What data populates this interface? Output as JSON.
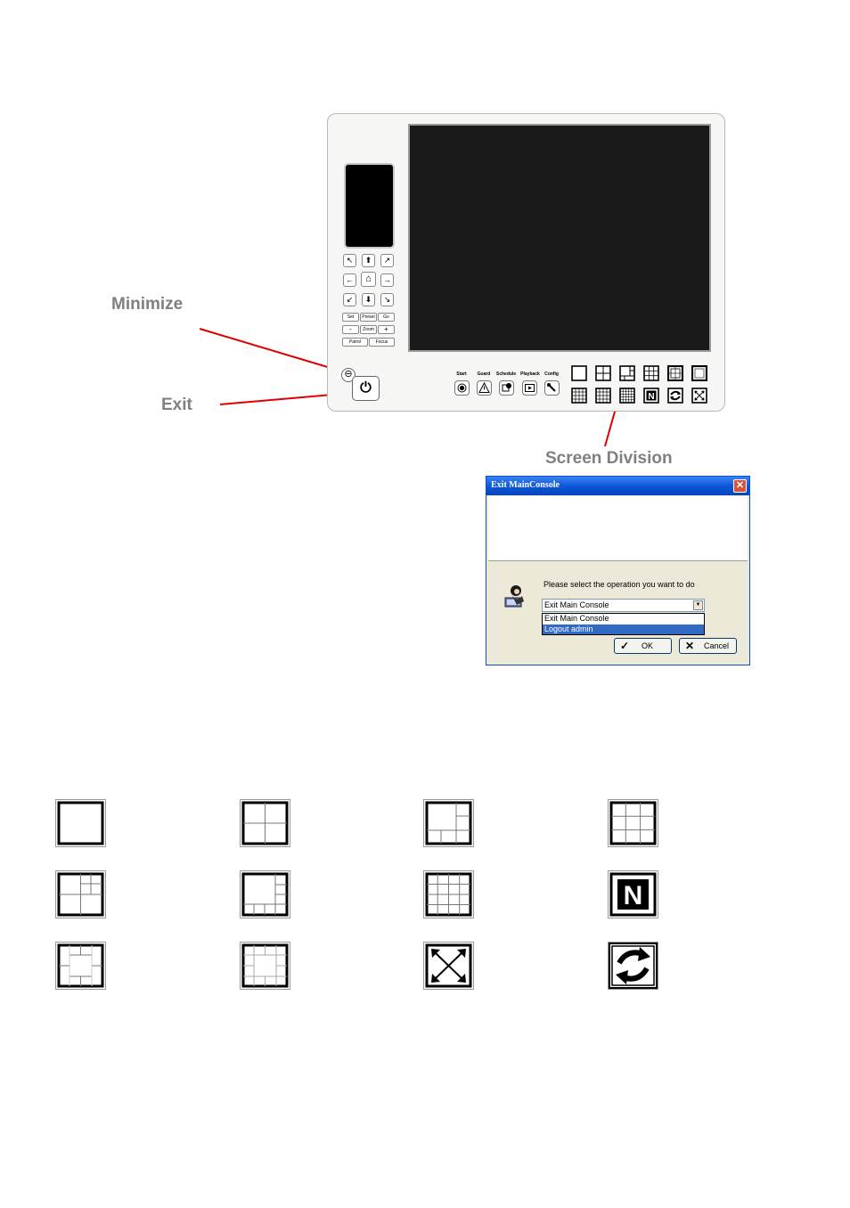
{
  "annotations": {
    "minimize": "Minimize",
    "exit": "Exit",
    "screen_division": "Screen Division"
  },
  "console": {
    "ptz_buttons": {
      "up_left": "↖",
      "up": "⬆",
      "up_right": "↗",
      "left": "←",
      "home": "⌂",
      "right": "→",
      "down_left": "↙",
      "down": "⬇",
      "down_right": "↘"
    },
    "preset_row": [
      "Set",
      "Preset",
      "Go"
    ],
    "zoom_row": [
      "-",
      "Zoom",
      "+"
    ],
    "focus_row": [
      "Patrol",
      "Focus"
    ],
    "controls": [
      {
        "label": "Start",
        "icon": "record-icon"
      },
      {
        "label": "Guard",
        "icon": "warning-icon"
      },
      {
        "label": "Schedule",
        "icon": "schedule-icon"
      },
      {
        "label": "Playback",
        "icon": "playback-icon"
      },
      {
        "label": "Config",
        "icon": "wrench-icon"
      }
    ],
    "minimize_glyph": "⊖",
    "exit_glyph": "⏻"
  },
  "dialog": {
    "title": "Exit MainConsole",
    "close_glyph": "✕",
    "prompt": "Please select the operation you want to do",
    "selected_value": "Exit Main Console",
    "options": [
      "Exit Main Console",
      "Logout admin"
    ],
    "highlighted_option": "Logout admin",
    "ok_label": "OK",
    "cancel_label": "Cancel",
    "ok_mark": "✓",
    "cancel_mark": "✕"
  },
  "legend_icons": {
    "n_letter": "N"
  },
  "colors": {
    "callout_text": "#808080",
    "callout_line": "#e00000",
    "xp_title_blue": "#0a55d8",
    "selection_blue": "#316ac5"
  }
}
